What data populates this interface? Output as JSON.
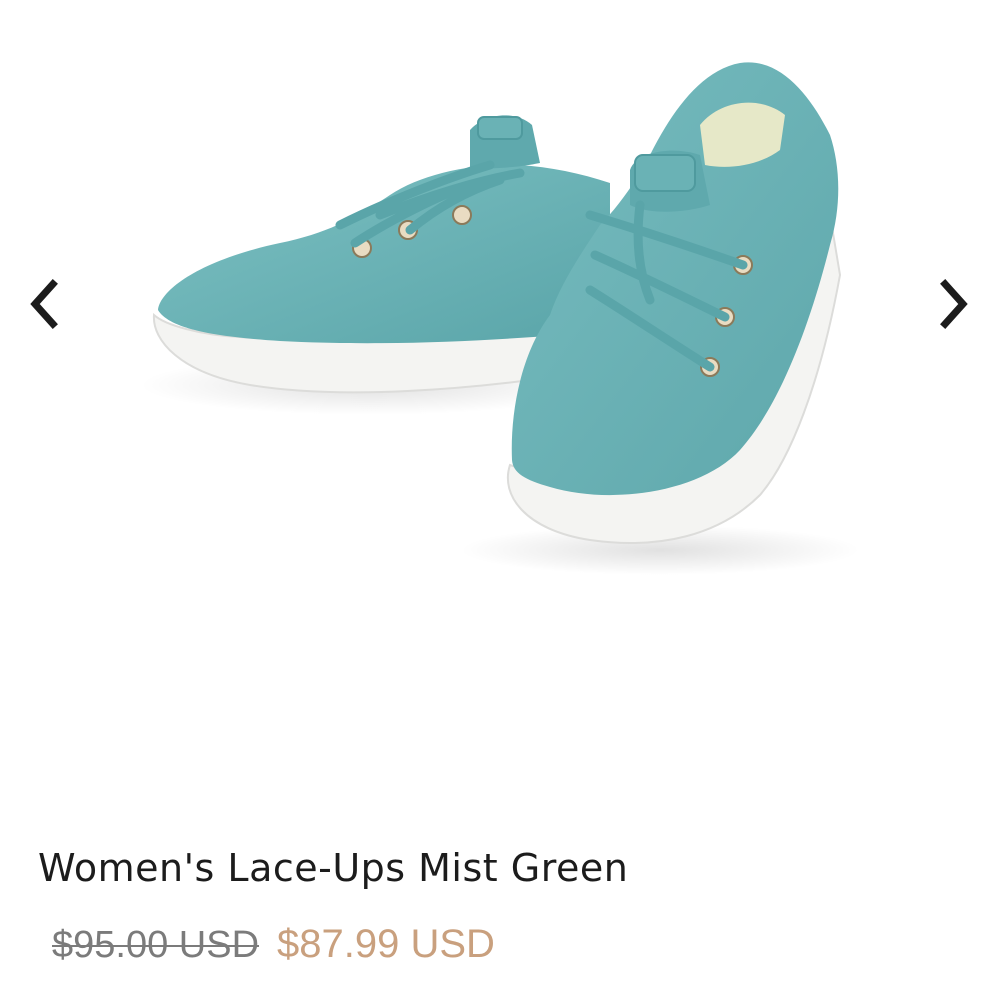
{
  "carousel": {
    "prev_icon": "chevron-left-icon",
    "next_icon": "chevron-right-icon",
    "image_alt": "Women's Lace-Ups Mist Green"
  },
  "product": {
    "title": "Women's Lace-Ups Mist Green",
    "original_price": "$95.00 USD",
    "sale_price": "$87.99 USD"
  },
  "colors": {
    "shoe_main": "#6bb3b6",
    "sole": "#f4f4f2",
    "sale_price": "#c9a07e",
    "original_price": "#7b7b7b",
    "title": "#1c1c1c"
  }
}
